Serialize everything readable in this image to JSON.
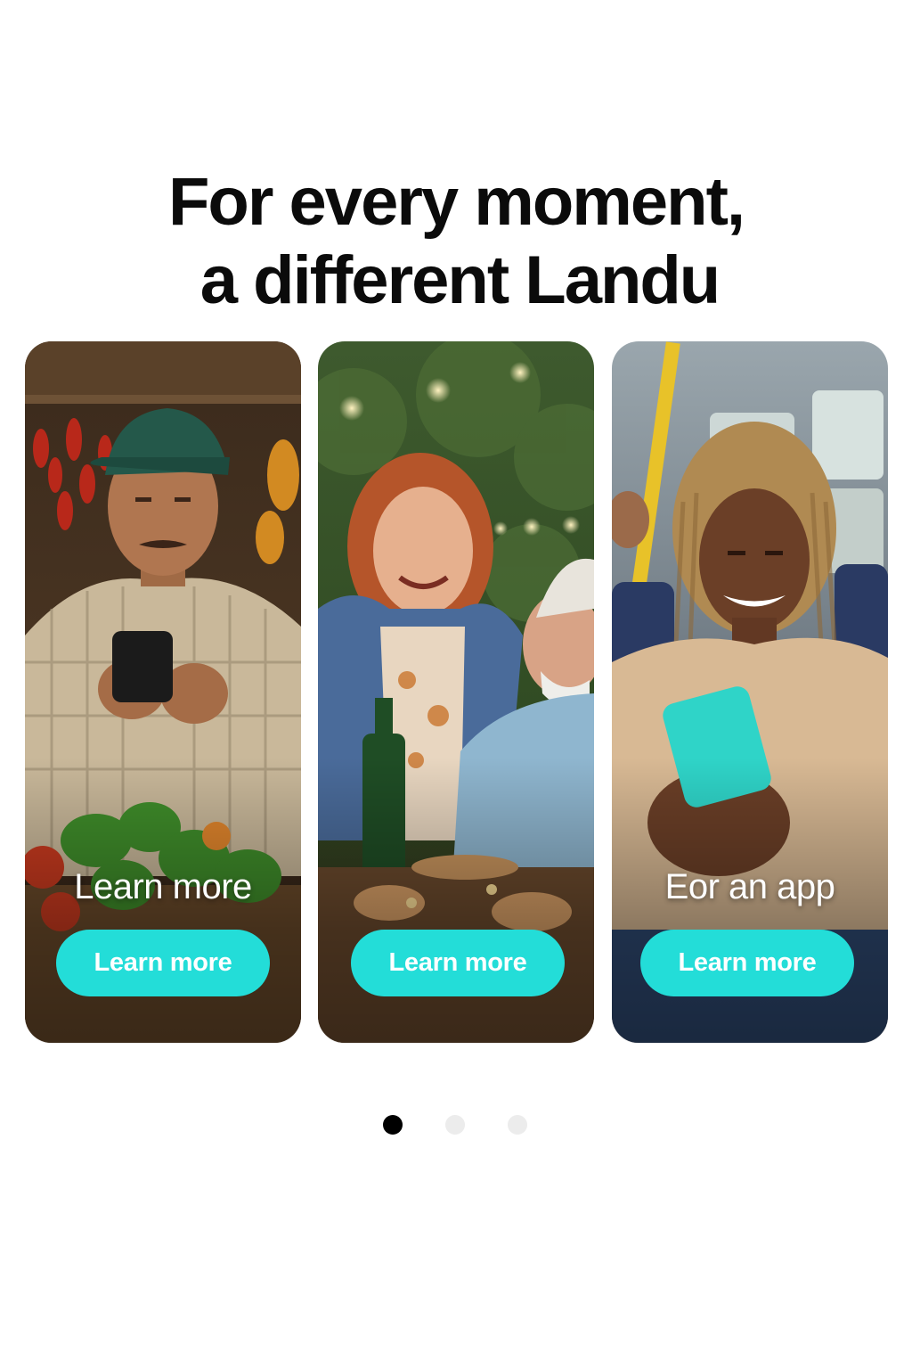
{
  "headline": {
    "line1": "For every moment,",
    "line2": "a different Landu"
  },
  "cards": [
    {
      "caption": "Learn more",
      "button_label": "Learn more",
      "scene": "market vendor with phone"
    },
    {
      "caption": "",
      "button_label": "Learn more",
      "scene": "family dinner outdoors"
    },
    {
      "caption": "Eor an app",
      "button_label": "Learn more",
      "scene": "woman on bus with phone"
    }
  ],
  "pagination": {
    "count": 3,
    "active_index": 0
  },
  "colors": {
    "accent": "#23ddd8",
    "headline": "#0b0b0b",
    "dot_active": "#000000",
    "dot_inactive": "#ececec"
  }
}
